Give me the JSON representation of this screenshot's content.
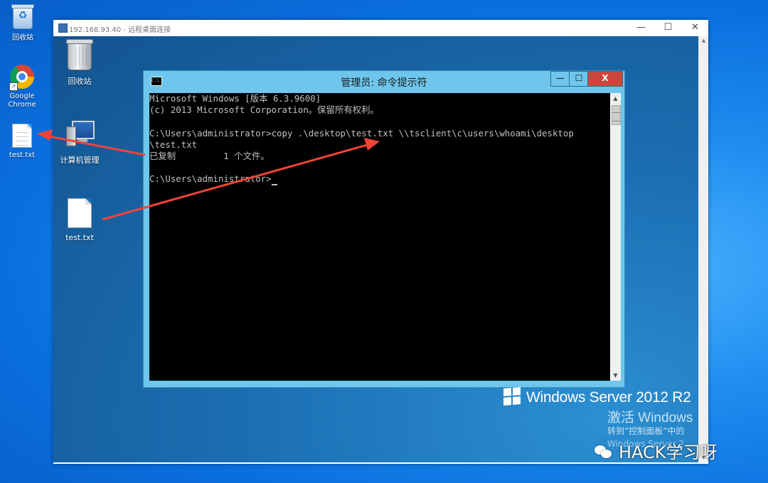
{
  "desktop": {
    "icons": [
      {
        "label": "回收站",
        "icon": "recycle-bin-icon"
      },
      {
        "label": "Google Chrome",
        "icon": "chrome-icon"
      },
      {
        "label": "test.txt",
        "icon": "text-file-icon"
      }
    ]
  },
  "rdp_window": {
    "title": "192.168.93.40 - 远程桌面连接",
    "controls": {
      "minimize": "—",
      "maximize": "☐",
      "close": "✕"
    }
  },
  "remote_desktop": {
    "icons": [
      {
        "label": "回收站",
        "icon": "recycle-bin-icon"
      },
      {
        "label": "计算机管理",
        "icon": "computer-management-icon"
      },
      {
        "label": "test.txt",
        "icon": "text-file-icon"
      }
    ],
    "os_branding": "Windows Server 2012 R2",
    "activation": {
      "title": "激活 Windows",
      "line1": "转到“控制面板”中的",
      "line2": "Windows Server 2"
    }
  },
  "cmd_window": {
    "title": "管理员: 命令提示符",
    "icon_text": "C:\\",
    "controls": {
      "minimize": "—",
      "maximize": "☐",
      "close": "X"
    },
    "lines": [
      "Microsoft Windows [版本 6.3.9600]",
      "(c) 2013 Microsoft Corporation。保留所有权利。",
      "",
      "C:\\Users\\administrator>copy .\\desktop\\test.txt \\\\tsclient\\c\\users\\whoami\\desktop",
      "\\test.txt",
      "已复制         1 个文件。",
      "",
      "C:\\Users\\administrator>"
    ]
  },
  "watermark": {
    "text": "HACK学习呀"
  },
  "annotation_colors": {
    "arrow": "#f04438"
  }
}
